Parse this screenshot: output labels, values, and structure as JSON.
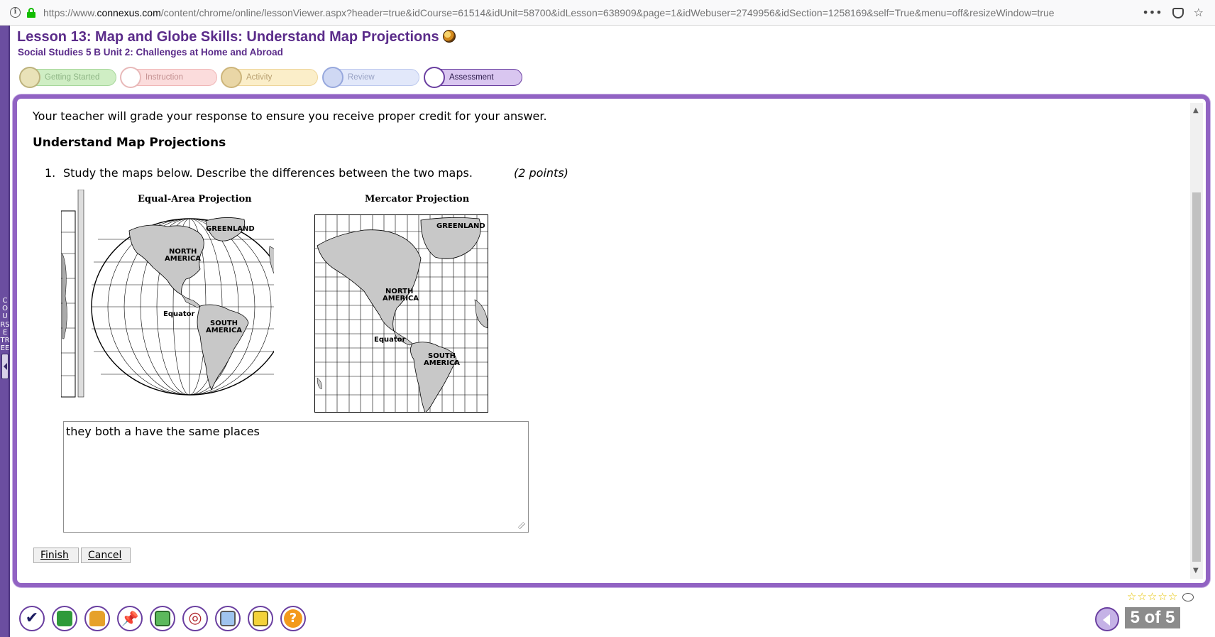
{
  "browser": {
    "url_prefix": "https://www.",
    "url_domain": "connexus.com",
    "url_rest": "/content/chrome/online/lessonViewer.aspx?header=true&idCourse=61514&idUnit=58700&idLesson=638909&page=1&idWebuser=2749956&idSection=1258169&self=True&menu=off&resizeWindow=true"
  },
  "sidebar": {
    "label": "COURSE TREE"
  },
  "header": {
    "lesson_title": "Lesson 13: Map and Globe Skills: Understand Map Projections",
    "course_subtitle": "Social Studies 5 B  Unit 2: Challenges at Home and Abroad"
  },
  "steps": [
    {
      "label": "Getting Started",
      "state": "visited"
    },
    {
      "label": "Instruction",
      "state": "visited"
    },
    {
      "label": "Activity",
      "state": "visited"
    },
    {
      "label": "Review",
      "state": "visited"
    },
    {
      "label": "Assessment",
      "state": "active"
    }
  ],
  "content": {
    "grading_note": "Your teacher will grade your response to ensure you receive proper credit for your answer.",
    "section_heading": "Understand Map Projections",
    "question": {
      "number": "1.",
      "text": "Study the maps below. Describe the differences between the two maps.",
      "points": "(2 points)"
    },
    "maps": {
      "equal_area": {
        "title": "Equal-Area Projection",
        "labels": {
          "greenland": "GREENLAND",
          "north": "NORTH",
          "america": "AMERICA",
          "equator": "Equator",
          "south": "SOUTH",
          "south_america": "AMERICA"
        }
      },
      "mercator": {
        "title": "Mercator Projection",
        "labels": {
          "greenland": "GREENLAND",
          "north": "NORTH",
          "america": "AMERICA",
          "equator": "Equator",
          "south": "SOUTH",
          "south_america": "AMERICA"
        }
      }
    },
    "answer_value": "they both a have the same places",
    "buttons": {
      "finish": "Finish",
      "cancel": "Cancel"
    }
  },
  "footer": {
    "tools": [
      "checkmark-icon",
      "book-icon",
      "backpack-icon",
      "pushpin-icon",
      "calculator-icon",
      "target-icon",
      "monitor-icon",
      "printer-icon",
      "help-icon"
    ],
    "rating_stars": 5,
    "page_counter": "5 of 5"
  },
  "colors": {
    "brand_purple": "#5b2c8a",
    "frame_purple": "#9163c3"
  }
}
